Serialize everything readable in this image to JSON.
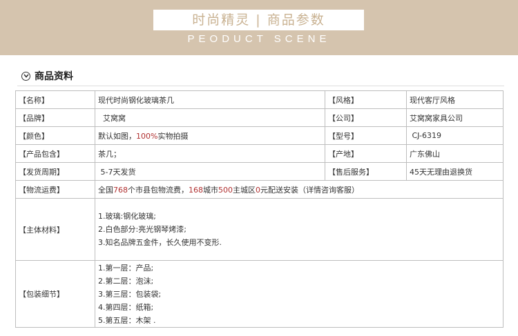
{
  "banner": {
    "title": "时尚精灵 | 商品参数",
    "subtitle": "PEODUCT SCENE"
  },
  "section": {
    "title": "商品资料"
  },
  "rows": [
    {
      "label": "【名称】",
      "value": "现代时尚钢化玻璃茶几",
      "label2": "【风格】",
      "value2": "现代客厅风格"
    },
    {
      "label": "【品牌】",
      "value": "艾窝窝",
      "label2": "【公司】",
      "value2": "艾窝窝家具公司"
    },
    {
      "label": "【颜色】",
      "value_pre": "默认如图，",
      "value_red": "100%",
      "value_post": "实物拍摄",
      "label2": "【型号】",
      "value2": "CJ-6319"
    },
    {
      "label": "【产品包含】",
      "value": "茶几；",
      "label2": "【产地】",
      "value2": "广东佛山"
    },
    {
      "label": "【发货周期】",
      "value": "5-7天发货",
      "label2": "【售后服务】",
      "value2": "45天无理由退换货"
    }
  ],
  "logistics": {
    "label": "【物流运费】",
    "p1": "全国",
    "n1": "768",
    "p2": "个市县包物流费，",
    "n2": "168",
    "p3": "城市",
    "n3": "500",
    "p4": "主城区",
    "n4": "0",
    "p5": "元配送安装（详情咨询客服）"
  },
  "material": {
    "label": "【主体材料】",
    "lines": [
      "1.玻璃:钢化玻璃;",
      "2.白色部分:亮光钢琴烤漆;",
      "3.知名品牌五金件，长久使用不变形."
    ]
  },
  "packaging": {
    "label": "【包装细节】",
    "lines": [
      "1.第一层：产品;",
      "2.第二层：泡沫;",
      "3.第三层：包装袋;",
      "4.第四层：纸箱;",
      "5.第五层：木架 ."
    ]
  }
}
